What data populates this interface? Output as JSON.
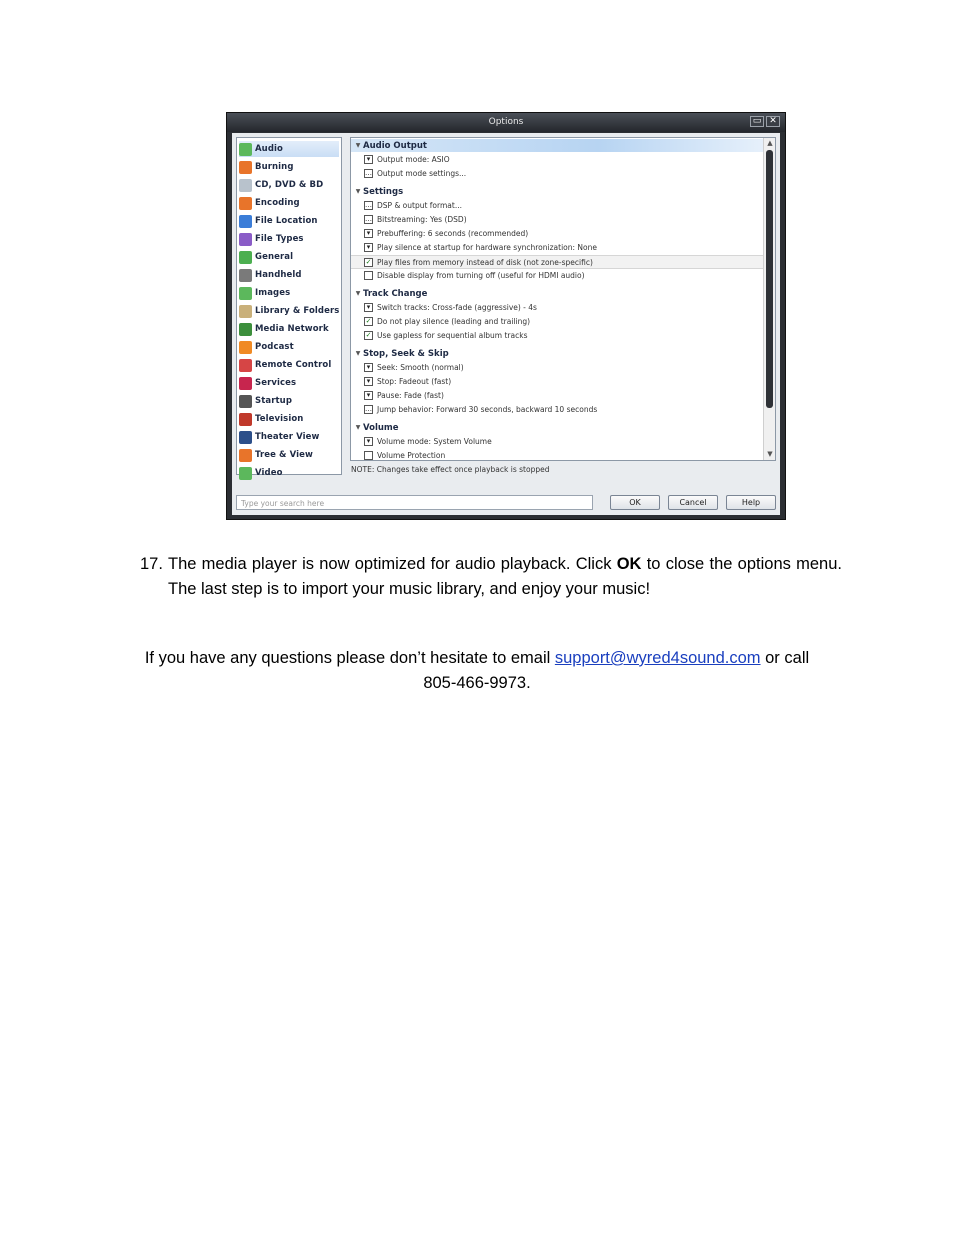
{
  "dialog": {
    "title": "Options",
    "maximize_glyph": "▭",
    "close_glyph": "✕",
    "sidebar": [
      {
        "label": "Audio",
        "icon": "audio-icon",
        "color": "#5cb85c",
        "selected": true
      },
      {
        "label": "Burning",
        "icon": "burning-icon",
        "color": "#e8742a"
      },
      {
        "label": "CD, DVD & BD",
        "icon": "disc-icon",
        "color": "#b8c2cc"
      },
      {
        "label": "Encoding",
        "icon": "encoding-icon",
        "color": "#e8742a"
      },
      {
        "label": "File Location",
        "icon": "file-location-icon",
        "color": "#3b7dd8"
      },
      {
        "label": "File Types",
        "icon": "file-types-icon",
        "color": "#8a5cc7"
      },
      {
        "label": "General",
        "icon": "general-icon",
        "color": "#4caf50"
      },
      {
        "label": "Handheld",
        "icon": "handheld-icon",
        "color": "#7a7a7a"
      },
      {
        "label": "Images",
        "icon": "images-icon",
        "color": "#5cb85c"
      },
      {
        "label": "Library & Folders",
        "icon": "library-icon",
        "color": "#c9b07a"
      },
      {
        "label": "Media Network",
        "icon": "media-network-icon",
        "color": "#3c8f3c"
      },
      {
        "label": "Podcast",
        "icon": "podcast-icon",
        "color": "#f08a24"
      },
      {
        "label": "Remote Control",
        "icon": "remote-control-icon",
        "color": "#d64545"
      },
      {
        "label": "Services",
        "icon": "services-icon",
        "color": "#c7254e"
      },
      {
        "label": "Startup",
        "icon": "startup-icon",
        "color": "#555555"
      },
      {
        "label": "Television",
        "icon": "television-icon",
        "color": "#c0392b"
      },
      {
        "label": "Theater View",
        "icon": "theater-view-icon",
        "color": "#2c4f8a"
      },
      {
        "label": "Tree & View",
        "icon": "tree-view-icon",
        "color": "#e8742a"
      },
      {
        "label": "Video",
        "icon": "video-icon",
        "color": "#5cb85c"
      }
    ],
    "rows": [
      {
        "type": "header",
        "label": "Audio Output"
      },
      {
        "type": "item",
        "control": "dropdown",
        "label": "Output mode: ASIO"
      },
      {
        "type": "item",
        "control": "button",
        "label": "Output mode settings..."
      },
      {
        "type": "section",
        "label": "Settings"
      },
      {
        "type": "item",
        "control": "button",
        "label": "DSP & output format..."
      },
      {
        "type": "item",
        "control": "button",
        "label": "Bitstreaming: Yes (DSD)"
      },
      {
        "type": "item",
        "control": "dropdown",
        "label": "Prebuffering: 6 seconds (recommended)"
      },
      {
        "type": "item",
        "control": "dropdown",
        "label": "Play silence at startup for hardware synchronization: None"
      },
      {
        "type": "item",
        "control": "checkbox",
        "checked": true,
        "highlight": true,
        "label": "Play files from memory instead of disk (not zone-specific)"
      },
      {
        "type": "item",
        "control": "checkbox",
        "checked": false,
        "label": "Disable display from turning off (useful for HDMI audio)"
      },
      {
        "type": "section",
        "label": "Track Change"
      },
      {
        "type": "item",
        "control": "dropdown",
        "label": "Switch tracks: Cross-fade (aggressive) - 4s"
      },
      {
        "type": "item",
        "control": "checkbox",
        "checked": true,
        "label": "Do not play silence (leading and trailing)"
      },
      {
        "type": "item",
        "control": "checkbox",
        "checked": true,
        "label": "Use gapless for sequential album tracks"
      },
      {
        "type": "section",
        "label": "Stop, Seek & Skip"
      },
      {
        "type": "item",
        "control": "dropdown",
        "label": "Seek: Smooth (normal)"
      },
      {
        "type": "item",
        "control": "dropdown",
        "label": "Stop: Fadeout (fast)"
      },
      {
        "type": "item",
        "control": "dropdown",
        "label": "Pause: Fade (fast)"
      },
      {
        "type": "item",
        "control": "button",
        "label": "Jump behavior: Forward 30 seconds, backward 10 seconds"
      },
      {
        "type": "section",
        "label": "Volume"
      },
      {
        "type": "item",
        "control": "dropdown",
        "label": "Volume mode: System Volume"
      },
      {
        "type": "item",
        "control": "checkbox",
        "checked": false,
        "label": "Volume Protection"
      }
    ],
    "note": "NOTE: Changes take effect once playback is stopped",
    "search_placeholder": "Type your search here",
    "buttons": {
      "ok": "OK",
      "cancel": "Cancel",
      "help": "Help"
    }
  },
  "step": {
    "number": "17.",
    "text_before": "The media player is now optimized for audio playback. Click ",
    "bold": "OK",
    "text_after": " to close the options menu. The last step is to import your music library, and enjoy your music!"
  },
  "closing": {
    "text_before": "If you have any questions please don’t hesitate to email ",
    "email": "support@wyred4sound.com",
    "text_after": " or call",
    "phone": "805-466-9973."
  },
  "colors": {
    "link": "#1a3fbf",
    "selection": "#c9def5"
  }
}
